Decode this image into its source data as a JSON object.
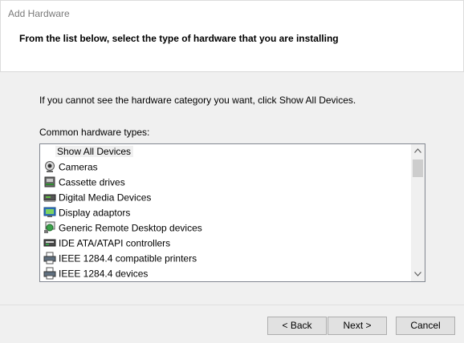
{
  "window": {
    "title": "Add Hardware"
  },
  "header": {
    "heading": "From the list below, select the type of hardware that you are installing"
  },
  "instruction": "If you cannot see the hardware category you want, click Show All Devices.",
  "list": {
    "label": "Common hardware types:",
    "items": [
      {
        "label": "Show All Devices",
        "icon": "none",
        "selected": true
      },
      {
        "label": "Cameras",
        "icon": "camera-icon"
      },
      {
        "label": "Cassette drives",
        "icon": "cassette-drive-icon"
      },
      {
        "label": "Digital Media Devices",
        "icon": "media-device-icon"
      },
      {
        "label": "Display adaptors",
        "icon": "display-adapter-icon"
      },
      {
        "label": "Generic Remote Desktop devices",
        "icon": "remote-desktop-icon"
      },
      {
        "label": "IDE ATA/ATAPI controllers",
        "icon": "ide-controller-icon"
      },
      {
        "label": "IEEE 1284.4 compatible printers",
        "icon": "printer-icon"
      },
      {
        "label": "IEEE 1284.4 devices",
        "icon": "printer-icon"
      }
    ]
  },
  "buttons": {
    "back": "< Back",
    "next": "Next >",
    "cancel": "Cancel"
  }
}
